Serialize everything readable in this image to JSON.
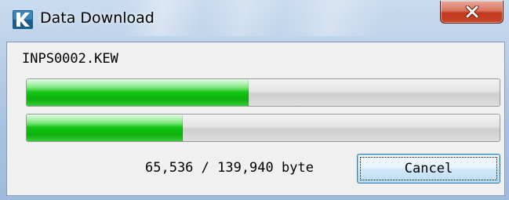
{
  "window": {
    "title": "Data Download",
    "icon": "kew-k-logo-icon",
    "close_icon": "close-x-icon",
    "accent": "#1d5d8a"
  },
  "download": {
    "filename": "INPS0002.KEW",
    "status": "65,536 / 139,940 byte",
    "cancel_label": "Cancel"
  },
  "progress": {
    "current_file_percent": 47,
    "total_percent": 33,
    "fill_color": "#13c313"
  }
}
